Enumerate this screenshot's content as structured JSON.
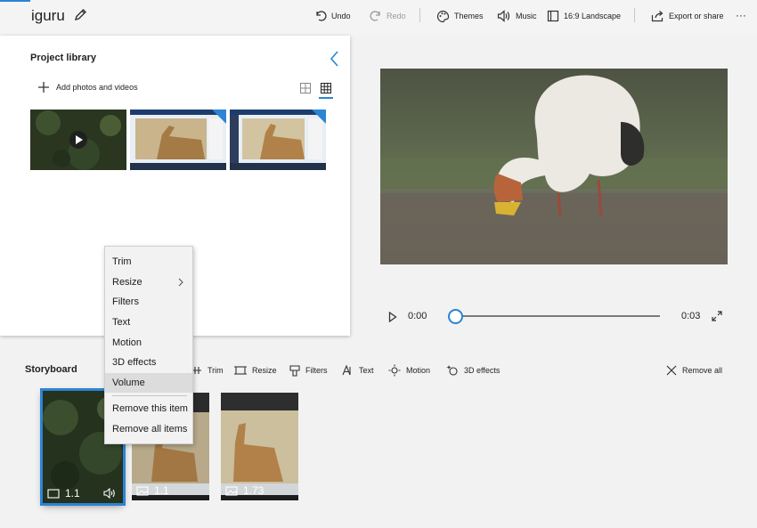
{
  "app": {
    "title": "iguru"
  },
  "toolbar": {
    "undo": "Undo",
    "redo": "Redo",
    "themes": "Themes",
    "music": "Music",
    "aspect": "16:9 Landscape",
    "export": "Export or share",
    "more": "···"
  },
  "library": {
    "title": "Project library",
    "add_label": "Add photos and videos",
    "thumbs": [
      {
        "kind": "video",
        "selected_tag": false
      },
      {
        "kind": "screenshot",
        "selected_tag": true
      },
      {
        "kind": "screenshot",
        "selected_tag": true
      }
    ]
  },
  "preview": {
    "current_time": "0:00",
    "duration": "0:03",
    "progress": 0
  },
  "context_menu": {
    "items": [
      "Trim",
      "Resize",
      "Filters",
      "Text",
      "Motion",
      "3D effects",
      "Volume",
      "Remove this item",
      "Remove all items"
    ],
    "hovered": "Volume"
  },
  "storyboard": {
    "title": "Storyboard",
    "tools": {
      "trim": "Trim",
      "resize": "Resize",
      "filters": "Filters",
      "text": "Text",
      "motion": "Motion",
      "effects": "3D effects"
    },
    "remove_all": "Remove all",
    "clips": [
      {
        "duration": "1.1",
        "type": "video",
        "selected": true
      },
      {
        "duration": "1.1",
        "type": "image",
        "selected": false
      },
      {
        "duration": "1.73",
        "type": "image",
        "selected": false
      }
    ]
  },
  "colors": {
    "accent": "#2b84d4"
  }
}
